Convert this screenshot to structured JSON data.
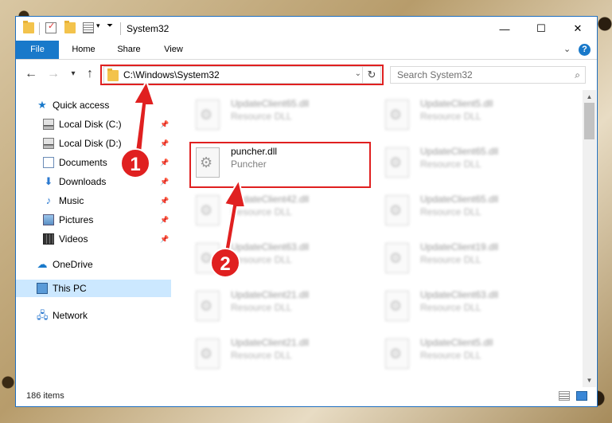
{
  "window": {
    "title": "System32",
    "controls": {
      "minimize": "—",
      "maximize": "☐",
      "close": "✕"
    }
  },
  "ribbon": {
    "tabs": [
      "File",
      "Home",
      "Share",
      "View"
    ],
    "expand_glyph": "⌄",
    "help_glyph": "?"
  },
  "address": {
    "path": "C:\\Windows\\System32",
    "search_placeholder": "Search System32"
  },
  "nav_pane": {
    "items": [
      {
        "label": "Quick access",
        "icon": "star-icon"
      },
      {
        "label": "Local Disk (C:)",
        "icon": "drive-icon",
        "pinned": true
      },
      {
        "label": "Local Disk (D:)",
        "icon": "drive-icon",
        "pinned": true
      },
      {
        "label": "Documents",
        "icon": "documents-icon",
        "pinned": true
      },
      {
        "label": "Downloads",
        "icon": "download-icon",
        "pinned": true
      },
      {
        "label": "Music",
        "icon": "music-icon",
        "pinned": true
      },
      {
        "label": "Pictures",
        "icon": "pictures-icon",
        "pinned": true
      },
      {
        "label": "Videos",
        "icon": "videos-icon",
        "pinned": true
      },
      {
        "label": "OneDrive",
        "icon": "cloud-icon"
      },
      {
        "label": "This PC",
        "icon": "computer-icon",
        "selected": true
      },
      {
        "label": "Network",
        "icon": "network-icon"
      }
    ]
  },
  "files": {
    "left_column": [
      {
        "name": "UpdateClient65.dll",
        "desc": "Resource DLL"
      },
      {
        "name": "puncher.dll",
        "desc": "Puncher",
        "highlighted": true
      },
      {
        "name": "UpdateClient42.dll",
        "desc": "Resource DLL"
      },
      {
        "name": "UpdateClient63.dll",
        "desc": "Resource DLL"
      },
      {
        "name": "UpdateClient21.dll",
        "desc": "Resource DLL"
      },
      {
        "name": "UpdateClient21.dll",
        "desc": "Resource DLL"
      }
    ],
    "right_column": [
      {
        "name": "UpdateClient5.dll",
        "desc": "Resource DLL"
      },
      {
        "name": "UpdateClient65.dll",
        "desc": "Resource DLL"
      },
      {
        "name": "UpdateClient65.dll",
        "desc": "Resource DLL"
      },
      {
        "name": "UpdateClient19.dll",
        "desc": "Resource DLL"
      },
      {
        "name": "UpdateClient63.dll",
        "desc": "Resource DLL"
      },
      {
        "name": "UpdateClient5.dll",
        "desc": "Resource DLL"
      }
    ]
  },
  "status": {
    "item_count": "186 items"
  },
  "annotations": {
    "step1": "1",
    "step2": "2",
    "accent_color": "#e02020"
  }
}
